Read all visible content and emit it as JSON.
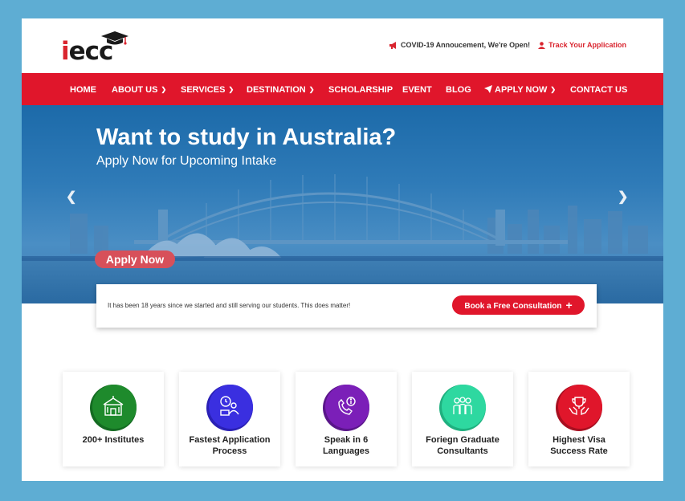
{
  "brand": {
    "logo_first": "i",
    "logo_rest": "ecc"
  },
  "top_bar": {
    "announcement": "COVID-19 Annoucement, We're Open!",
    "announcement_icon": "megaphone-icon",
    "track": "Track Your Application",
    "track_icon": "user-icon"
  },
  "nav": {
    "items": [
      {
        "label": "HOME",
        "dropdown": false
      },
      {
        "label": "ABOUT US",
        "dropdown": true
      },
      {
        "label": "SERVICES",
        "dropdown": true
      },
      {
        "label": "DESTINATION",
        "dropdown": true
      },
      {
        "label": "SCHOLARSHIP",
        "dropdown": false
      },
      {
        "label": "EVENT",
        "dropdown": false
      },
      {
        "label": "BLOG",
        "dropdown": false
      },
      {
        "label": "APPLY NOW",
        "dropdown": true,
        "icon": "paper-plane-icon"
      },
      {
        "label": "CONTACT US",
        "dropdown": false
      }
    ]
  },
  "hero": {
    "title": "Want to study in Australia?",
    "subtitle": "Apply Now for Upcoming Intake",
    "cta": "Apply Now",
    "prev_icon": "chevron-left-icon",
    "next_icon": "chevron-right-icon"
  },
  "info_bar": {
    "text": "It has been 18 years since we started and still serving our students. This does matter!",
    "button": "Book a Free Consultation",
    "button_icon": "plus-icon"
  },
  "features": [
    {
      "label_line1": "200+ Institutes",
      "label_line2": "",
      "icon": "institution-icon",
      "color": "#1e8a2c"
    },
    {
      "label_line1": "Fastest Application",
      "label_line2": "Process",
      "icon": "fast-process-icon",
      "color": "#3a2fe0"
    },
    {
      "label_line1": "Speak in 6",
      "label_line2": "Languages",
      "icon": "phone-info-icon",
      "color": "#7b1fb8"
    },
    {
      "label_line1": "Foriegn Graduate",
      "label_line2": "Consultants",
      "icon": "graduates-icon",
      "color": "#2ed8a0"
    },
    {
      "label_line1": "Highest Visa",
      "label_line2": "Success Rate",
      "icon": "trophy-hands-icon",
      "color": "#e0162b"
    }
  ],
  "colors": {
    "brand_red": "#e0162b",
    "page_border": "#5eadd3",
    "hero_blue": "#2f7bb8"
  }
}
